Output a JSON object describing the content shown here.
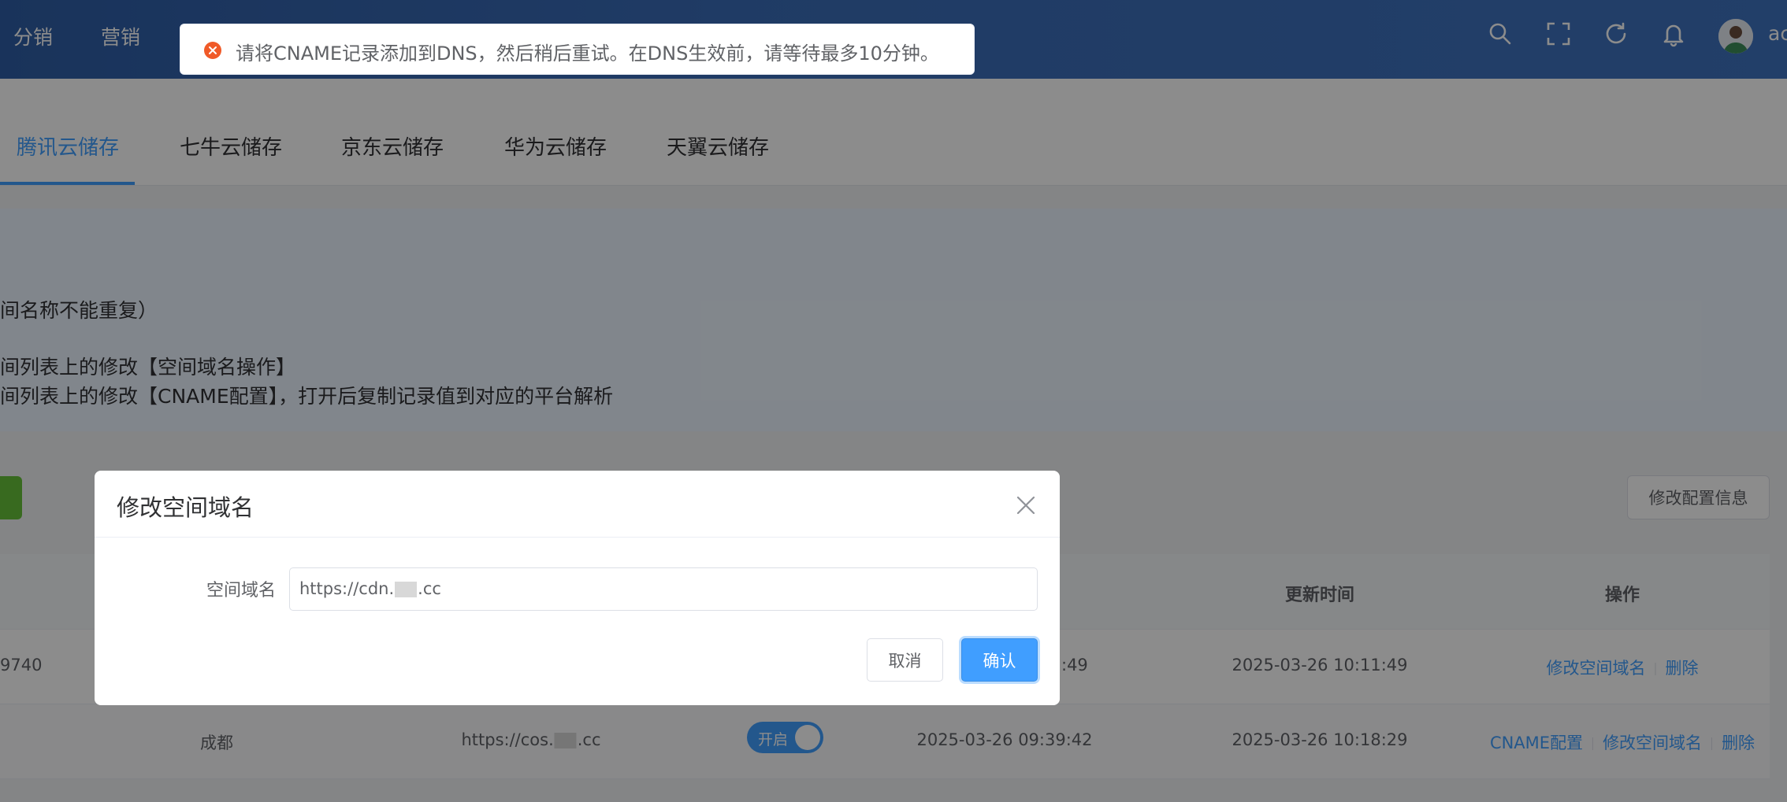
{
  "header": {
    "nav": [
      "分销",
      "营销"
    ],
    "username": "ac"
  },
  "toast": {
    "message": "请将CNAME记录添加到DNS，然后稍后重试。在DNS生效前，请等待最多10分钟。",
    "type": "error"
  },
  "tabs": [
    "腾讯云储存",
    "七牛云储存",
    "京东云储存",
    "华为云储存",
    "天翼云储存"
  ],
  "active_tab": 0,
  "info_lines": [
    "间名称不能重复）",
    "间列表上的修改【空间域名操作】",
    "间列表上的修改【CNAME配置】，打开后复制记录值到对应的平台解析"
  ],
  "toolbar": {
    "config_button": "修改配置信息"
  },
  "table": {
    "headers": {
      "update_time": "更新时间",
      "actions": "操作"
    },
    "rows": [
      {
        "id_fragment": "9740",
        "created_fragment": ":49",
        "updated": "2025-03-26 10:11:49",
        "actions": [
          "修改空间域名",
          "删除"
        ]
      },
      {
        "region": "成都",
        "domain_prefix": "https://cos.",
        "domain_suffix": ".cc",
        "status": "开启",
        "created": "2025-03-26 09:39:42",
        "updated": "2025-03-26 10:18:29",
        "actions": [
          "CNAME配置",
          "修改空间域名",
          "删除"
        ]
      }
    ]
  },
  "dialog": {
    "title": "修改空间域名",
    "field_label": "空间域名",
    "field_value_prefix": "https://cdn.",
    "field_value_suffix": ".cc",
    "cancel": "取消",
    "confirm": "确认"
  },
  "colors": {
    "primary": "#409eff",
    "header": "#3a6cb8",
    "error": "#f56c6c",
    "success": "#67c23a"
  }
}
